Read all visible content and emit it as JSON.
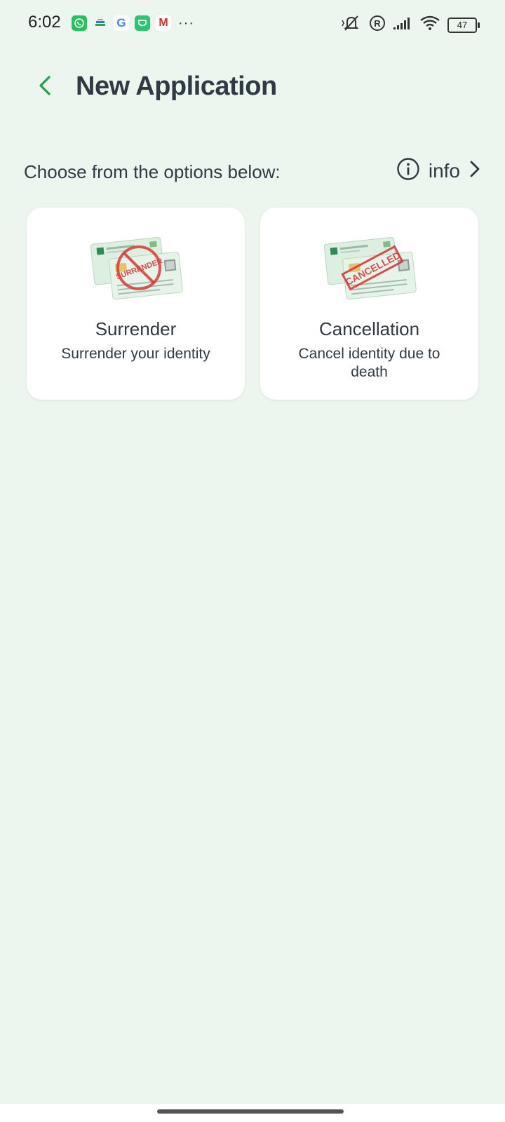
{
  "status_bar": {
    "time": "6:02",
    "battery": "47",
    "notification_icons": [
      "whatsapp-icon",
      "cloud-icon",
      "google-icon",
      "shield-icon",
      "gmail-icon"
    ],
    "more": "···"
  },
  "header": {
    "title": "New Application"
  },
  "prompt": {
    "text": "Choose from the options below:",
    "info_label": "info"
  },
  "cards": [
    {
      "title": "Surrender",
      "description": "Surrender your identity",
      "stamp": "SURRENDER"
    },
    {
      "title": "Cancellation",
      "description": "Cancel identity due to death",
      "stamp": "CANCELLED"
    }
  ],
  "colors": {
    "background": "#EDF6EE",
    "accent": "#1FA34A",
    "text": "#2F3A45",
    "card": "#FFFFFF",
    "stamp_red": "#D9383A"
  }
}
